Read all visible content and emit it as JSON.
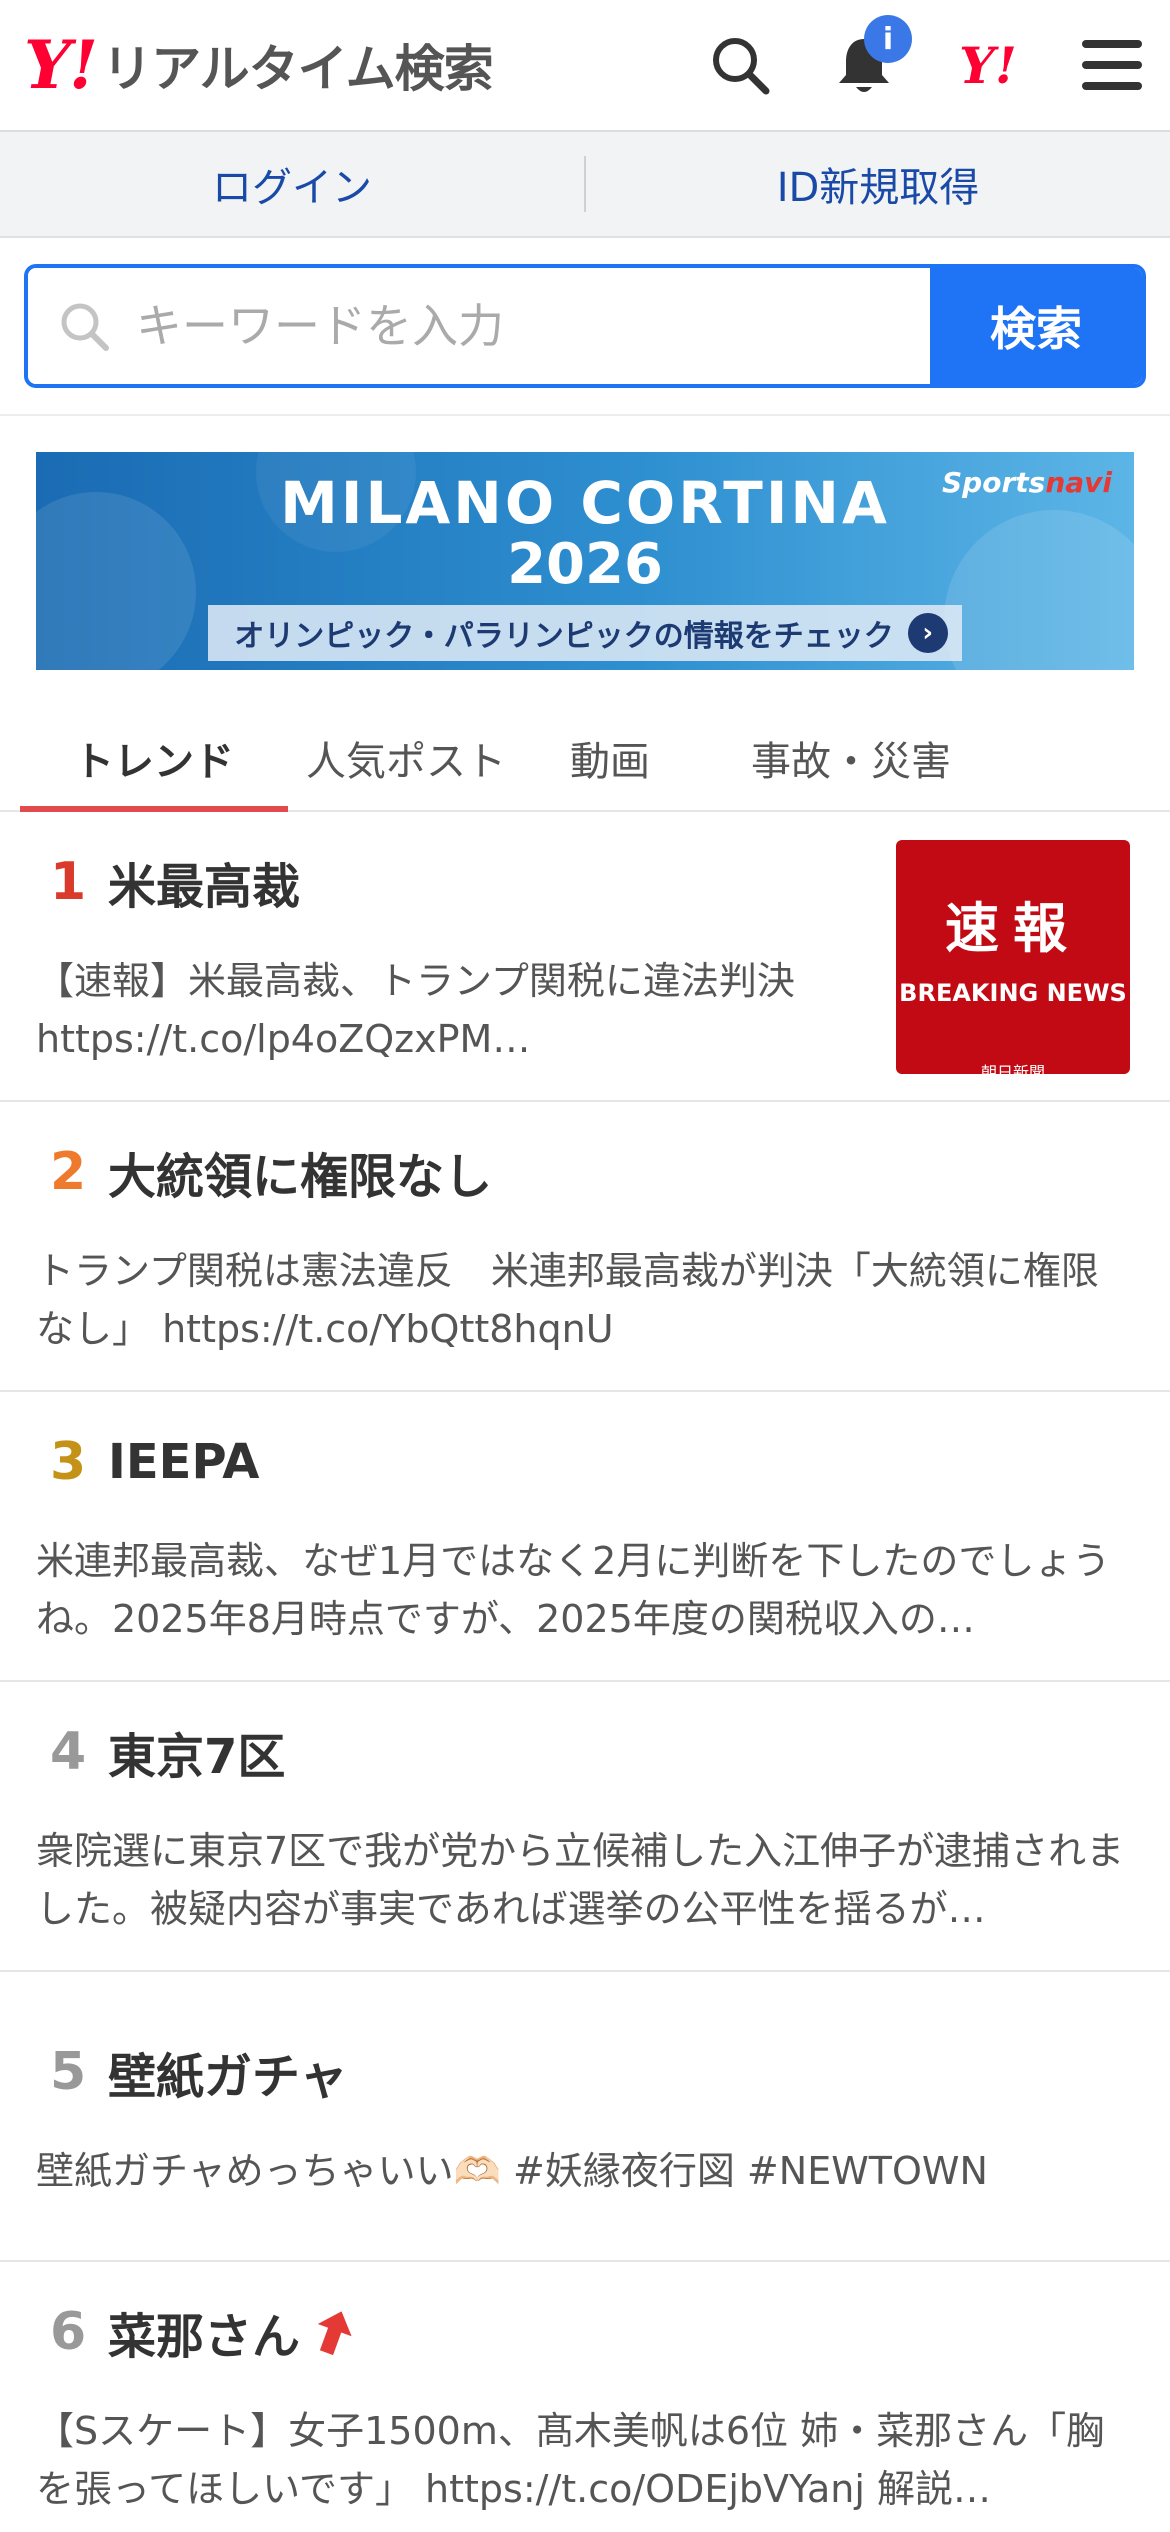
{
  "header": {
    "logo_y": "Y!",
    "logo_text": "リアルタイム検索",
    "notification_badge": "i",
    "yahoo_mark": "Y!",
    "icons": [
      "search-icon",
      "bell-icon",
      "yahoo-logo",
      "menu-icon"
    ]
  },
  "login_bar": {
    "login": "ログイン",
    "register": "ID新規取得"
  },
  "search": {
    "placeholder": "キーワードを入力",
    "button": "検索"
  },
  "banner": {
    "title": "MILANO CORTINA",
    "year": "2026",
    "subtitle": "オリンピック・パラリンピックの情報をチェック",
    "brand_a": "Sports",
    "brand_b": "navi"
  },
  "tabs": [
    "トレンド",
    "人気ポスト",
    "動画",
    "事故・災害"
  ],
  "trends": [
    {
      "rank": "1",
      "title": "米最高裁",
      "desc": "【速報】米最高裁、トランプ関税に違法判決 https://t.co/lp4oZQzxPM…"
    },
    {
      "rank": "2",
      "title": "大統領に権限なし",
      "desc": "トランプ関税は憲法違反　米連邦最高裁が判決「大統領に権限なし」 https://t.co/YbQtt8hqnU"
    },
    {
      "rank": "3",
      "title": "IEEPA",
      "desc": "米連邦最高裁、なぜ1月ではなく2月に判断を下したのでしょうね。2025年8月時点ですが、2025年度の関税収入の…"
    },
    {
      "rank": "4",
      "title": "東京7区",
      "desc": "衆院選に東京7区で我が党から立候補した入江伸子が逮捕されました。被疑内容が事実であれば選挙の公平性を揺るが…"
    },
    {
      "rank": "5",
      "title": "壁紙ガチャ",
      "desc": "壁紙ガチャめっちゃいい🫶🏻 #妖縁夜行図 #NEWTOWN"
    },
    {
      "rank": "6",
      "title": "菜那さん",
      "desc": "【Sスケート】女子1500m、髙木美帆は6位 姉・菜那さん「胸を張ってほしいです」 https://t.co/ODEjbVYanj 解説…"
    }
  ],
  "thumb": {
    "main": "速報",
    "sub": "BREAKING NEWS",
    "source": "朝日新聞"
  },
  "colors": {
    "accent_blue": "#1e74f5",
    "yahoo_red": "#ff0033",
    "tab_underline": "#e14b4b",
    "rank1": "#d93a2b",
    "rank2": "#ee7a2d",
    "rank3": "#c49217"
  }
}
